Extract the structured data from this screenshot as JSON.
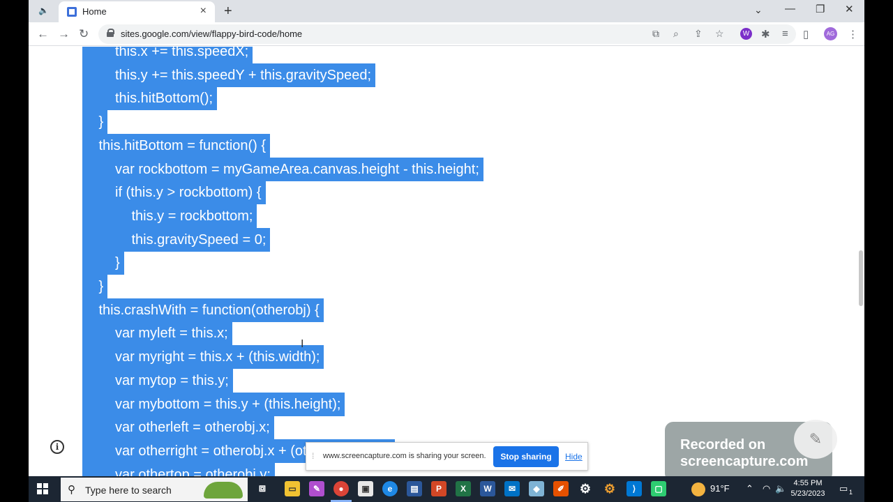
{
  "browser": {
    "tab_title": "Home",
    "url": "sites.google.com/view/flappy-bird-code/home",
    "avatar_initials": "AG",
    "extension_letter": "W"
  },
  "code": {
    "lines": [
      {
        "indent": 2,
        "text": "this.x += this.speedX;"
      },
      {
        "indent": 2,
        "text": "this.y += this.speedY + this.gravitySpeed;"
      },
      {
        "indent": 2,
        "text": "this.hitBottom();"
      },
      {
        "indent": 1,
        "text": "}"
      },
      {
        "indent": 1,
        "text": "this.hitBottom = function() {"
      },
      {
        "indent": 2,
        "text": "var rockbottom = myGameArea.canvas.height - this.height;"
      },
      {
        "indent": 2,
        "text": "if (this.y > rockbottom) {"
      },
      {
        "indent": 3,
        "text": "this.y = rockbottom;"
      },
      {
        "indent": 3,
        "text": "this.gravitySpeed = 0;"
      },
      {
        "indent": 2,
        "text": "}"
      },
      {
        "indent": 1,
        "text": "}"
      },
      {
        "indent": 1,
        "text": "this.crashWith = function(otherobj) {"
      },
      {
        "indent": 2,
        "text": "var myleft = this.x;"
      },
      {
        "indent": 2,
        "text": "var myright = this.x + (this.width);"
      },
      {
        "indent": 2,
        "text": "var mytop = this.y;"
      },
      {
        "indent": 2,
        "text": "var mybottom = this.y + (this.height);"
      },
      {
        "indent": 2,
        "text": "var otherleft = otherobj.x;"
      },
      {
        "indent": 2,
        "text": "var otherright = otherobj.x + (otherobj.width);"
      },
      {
        "indent": 2,
        "text": "var othertop = otherobj.y;"
      }
    ]
  },
  "sharebar": {
    "message": "www.screencapture.com is sharing your screen.",
    "stop_label": "Stop sharing",
    "hide_label": "Hide"
  },
  "watermark": {
    "line1": "Recorded on",
    "line2": "screencapture.com"
  },
  "taskbar": {
    "search_placeholder": "Type here to search",
    "weather": "91°F",
    "time": "4:55 PM",
    "date": "5/23/2023",
    "notification_count": "1"
  },
  "colors": {
    "selection": "#3b8ce8",
    "taskbar": "#1c2633",
    "accent": "#1a73e8"
  }
}
